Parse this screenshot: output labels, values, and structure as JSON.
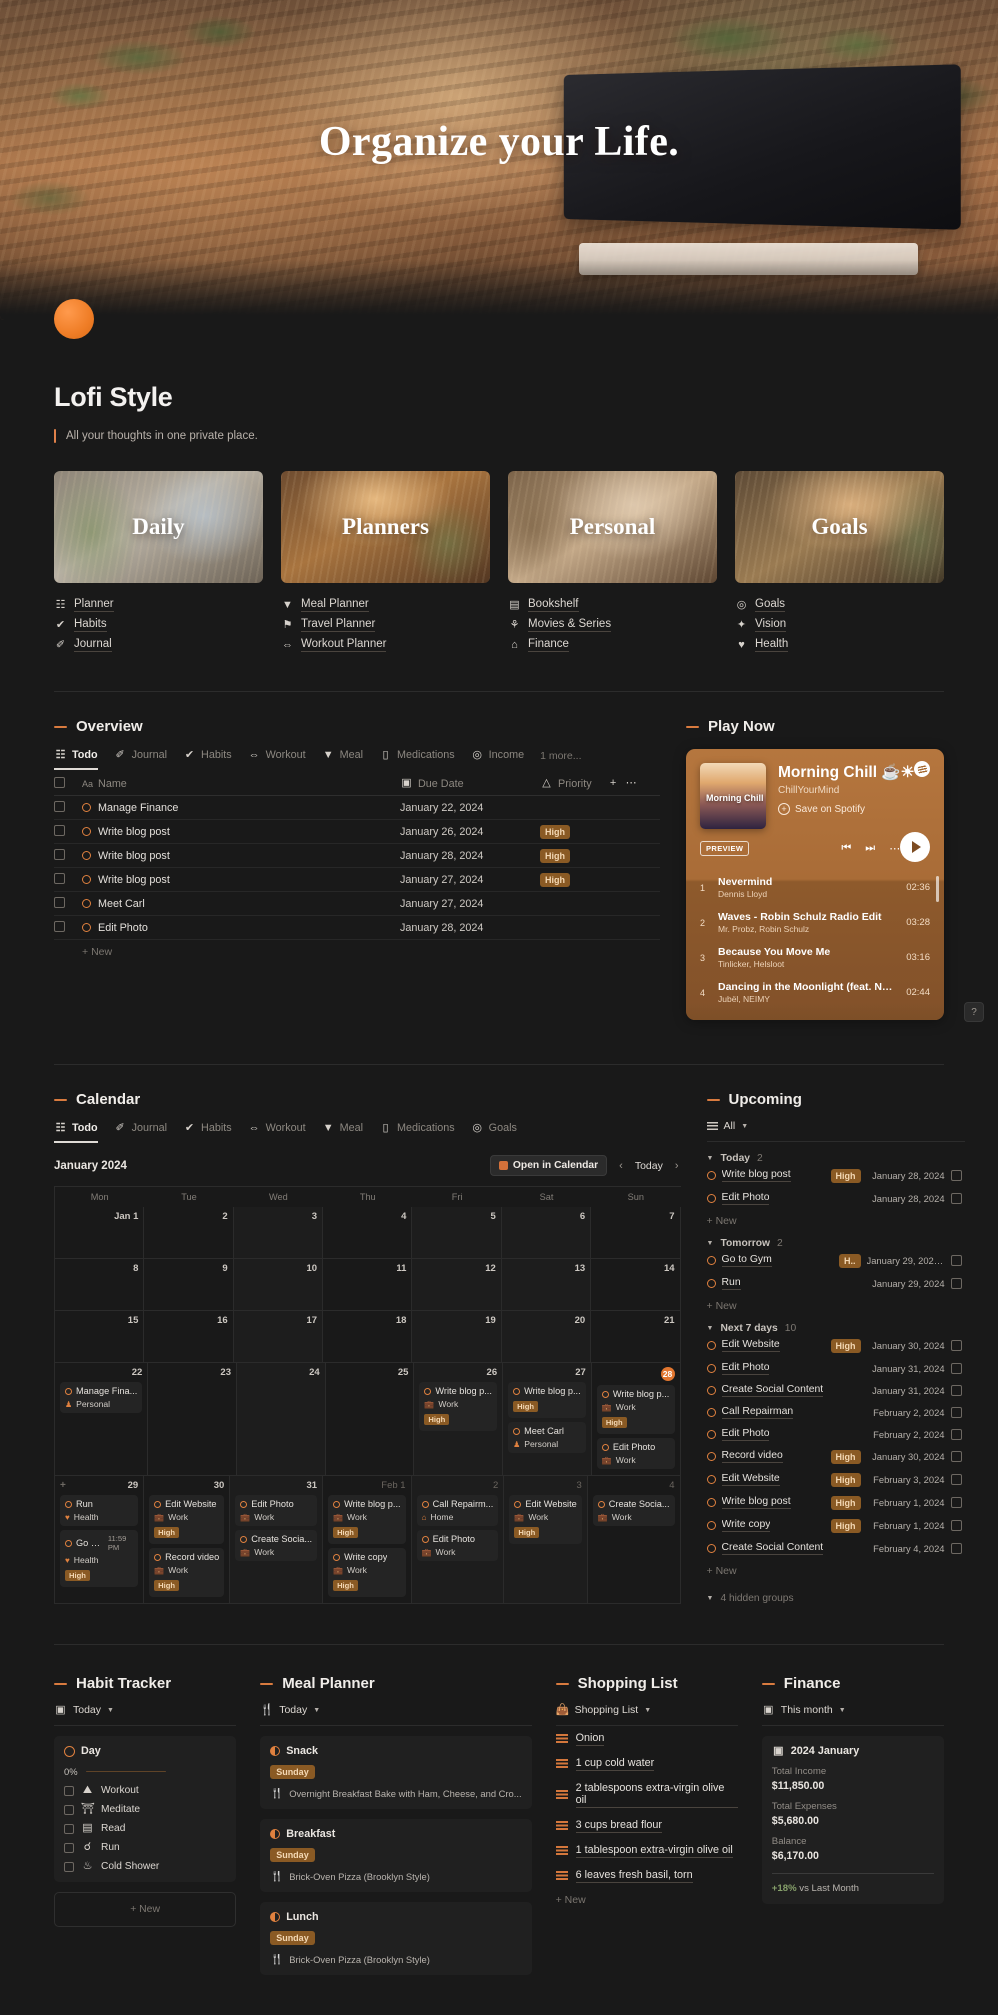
{
  "hero": {
    "title": "Organize your Life.",
    "icon": "orange-circle-icon"
  },
  "page": {
    "title": "Lofi Style",
    "callout": "All your thoughts in one private place."
  },
  "cards": [
    {
      "caption": "Daily",
      "links": [
        {
          "icon": "calendar-icon",
          "glyph": "☷",
          "label": "Planner"
        },
        {
          "icon": "check-circle-icon",
          "glyph": "✔",
          "label": "Habits"
        },
        {
          "icon": "pen-icon",
          "glyph": "✐",
          "label": "Journal"
        }
      ]
    },
    {
      "caption": "Planners",
      "links": [
        {
          "icon": "bowl-icon",
          "glyph": "▼",
          "label": "Meal Planner"
        },
        {
          "icon": "pin-icon",
          "glyph": "⚑",
          "label": "Travel Planner"
        },
        {
          "icon": "dumbbell-icon",
          "glyph": "⇔",
          "label": "Workout Planner"
        }
      ]
    },
    {
      "caption": "Personal",
      "links": [
        {
          "icon": "book-icon",
          "glyph": "▤",
          "label": "Bookshelf"
        },
        {
          "icon": "film-icon",
          "glyph": "⚘",
          "label": "Movies & Series"
        },
        {
          "icon": "bank-icon",
          "glyph": "⌂",
          "label": "Finance"
        }
      ]
    },
    {
      "caption": "Goals",
      "links": [
        {
          "icon": "target-icon",
          "glyph": "◎",
          "label": "Goals"
        },
        {
          "icon": "sparkle-icon",
          "glyph": "✦",
          "label": "Vision"
        },
        {
          "icon": "heart-icon",
          "glyph": "♥",
          "label": "Health"
        }
      ]
    }
  ],
  "overview": {
    "heading": "Overview",
    "tabs": [
      {
        "label": "Todo",
        "glyph": "☷",
        "active": true
      },
      {
        "label": "Journal",
        "glyph": "✐",
        "active": false
      },
      {
        "label": "Habits",
        "glyph": "✔",
        "active": false
      },
      {
        "label": "Workout",
        "glyph": "⇔",
        "active": false
      },
      {
        "label": "Meal",
        "glyph": "▼",
        "active": false
      },
      {
        "label": "Medications",
        "glyph": "▯",
        "active": false
      },
      {
        "label": "Income",
        "glyph": "◎",
        "active": false
      }
    ],
    "tab_more": "1 more...",
    "columns": {
      "name": "Name",
      "name_prefix": "Aa",
      "due": "Due Date",
      "priority": "Priority"
    },
    "rows": [
      {
        "name": "Manage Finance",
        "due": "January 22, 2024",
        "priority": ""
      },
      {
        "name": "Write blog post",
        "due": "January 26, 2024",
        "priority": "High"
      },
      {
        "name": "Write blog post",
        "due": "January 28, 2024",
        "priority": "High"
      },
      {
        "name": "Write blog post",
        "due": "January 27, 2024",
        "priority": "High"
      },
      {
        "name": "Meet Carl",
        "due": "January 27, 2024",
        "priority": ""
      },
      {
        "name": "Edit Photo",
        "due": "January 28, 2024",
        "priority": ""
      }
    ],
    "new_label": "New"
  },
  "play_now": {
    "heading": "Play Now",
    "cover_label": "Morning Chill",
    "title": "Morning Chill ☕☀",
    "artist": "ChillYourMind",
    "save_label": "Save on Spotify",
    "preview_label": "PREVIEW",
    "tracks": [
      {
        "num": "1",
        "name": "Nevermind",
        "artist": "Dennis Lloyd",
        "duration": "02:36"
      },
      {
        "num": "2",
        "name": "Waves - Robin Schulz Radio Edit",
        "artist": "Mr. Probz, Robin Schulz",
        "duration": "03:28"
      },
      {
        "num": "3",
        "name": "Because You Move Me",
        "artist": "Tinlicker, Helsloot",
        "duration": "03:16"
      },
      {
        "num": "4",
        "name": "Dancing in the Moonlight (feat. NEIMY)",
        "artist": "Jubël, NEIMY",
        "duration": "02:44"
      }
    ]
  },
  "calendar": {
    "heading": "Calendar",
    "tabs": [
      {
        "label": "Todo",
        "glyph": "☷",
        "active": true
      },
      {
        "label": "Journal",
        "glyph": "✐",
        "active": false
      },
      {
        "label": "Habits",
        "glyph": "✔",
        "active": false
      },
      {
        "label": "Workout",
        "glyph": "⇔",
        "active": false
      },
      {
        "label": "Meal",
        "glyph": "▼",
        "active": false
      },
      {
        "label": "Medications",
        "glyph": "▯",
        "active": false
      },
      {
        "label": "Goals",
        "glyph": "◎",
        "active": false
      }
    ],
    "month": "January 2024",
    "open_in_calendar": "Open in Calendar",
    "today": "Today",
    "prev": "‹",
    "next": "›",
    "dow": [
      "Mon",
      "Tue",
      "Wed",
      "Thu",
      "Fri",
      "Sat",
      "Sun"
    ],
    "weeks": [
      {
        "tall": false,
        "days": [
          {
            "num": "Jan 1",
            "alt": false,
            "events": []
          },
          {
            "num": "2",
            "alt": false,
            "events": []
          },
          {
            "num": "3",
            "alt": true,
            "events": []
          },
          {
            "num": "4",
            "alt": false,
            "events": []
          },
          {
            "num": "5",
            "alt": true,
            "events": []
          },
          {
            "num": "6",
            "alt": true,
            "events": []
          },
          {
            "num": "7",
            "alt": false,
            "events": []
          }
        ]
      },
      {
        "tall": false,
        "days": [
          {
            "num": "8",
            "alt": false,
            "events": []
          },
          {
            "num": "9",
            "alt": false,
            "events": []
          },
          {
            "num": "10",
            "alt": true,
            "events": []
          },
          {
            "num": "11",
            "alt": false,
            "events": []
          },
          {
            "num": "12",
            "alt": true,
            "events": []
          },
          {
            "num": "13",
            "alt": true,
            "events": []
          },
          {
            "num": "14",
            "alt": false,
            "events": []
          }
        ]
      },
      {
        "tall": false,
        "days": [
          {
            "num": "15",
            "alt": false,
            "events": []
          },
          {
            "num": "16",
            "alt": false,
            "events": []
          },
          {
            "num": "17",
            "alt": true,
            "events": []
          },
          {
            "num": "18",
            "alt": false,
            "events": []
          },
          {
            "num": "19",
            "alt": true,
            "events": []
          },
          {
            "num": "20",
            "alt": true,
            "events": []
          },
          {
            "num": "21",
            "alt": false,
            "events": []
          }
        ]
      },
      {
        "tall": true,
        "days": [
          {
            "num": "22",
            "alt": false,
            "events": [
              {
                "title": "Manage Fina...",
                "tag": "Personal",
                "tag_icon": "person-icon",
                "priority": ""
              }
            ]
          },
          {
            "num": "23",
            "alt": false,
            "events": []
          },
          {
            "num": "24",
            "alt": true,
            "events": []
          },
          {
            "num": "25",
            "alt": false,
            "events": []
          },
          {
            "num": "26",
            "alt": true,
            "events": [
              {
                "title": "Write blog p...",
                "tag": "Work",
                "tag_icon": "briefcase-icon",
                "priority": "High"
              }
            ]
          },
          {
            "num": "27",
            "alt": true,
            "events": [
              {
                "title": "Write blog p...",
                "tag": "",
                "tag_icon": "",
                "priority": "High"
              },
              {
                "title": "Meet Carl",
                "tag": "Personal",
                "tag_icon": "person-icon",
                "priority": ""
              }
            ]
          },
          {
            "num": "28",
            "alt": false,
            "today": true,
            "events": [
              {
                "title": "Write blog p...",
                "tag": "Work",
                "tag_icon": "briefcase-icon",
                "priority": "High"
              },
              {
                "title": "Edit Photo",
                "tag": "Work",
                "tag_icon": "briefcase-icon",
                "priority": ""
              }
            ]
          }
        ]
      },
      {
        "tall": true,
        "days": [
          {
            "num": "29",
            "alt": false,
            "plus": true,
            "events": [
              {
                "title": "Run",
                "tag": "Health",
                "tag_icon": "heart-icon",
                "priority": ""
              },
              {
                "title": "Go to ...",
                "time": "11:59 PM",
                "tag": "Health",
                "tag_icon": "heart-icon",
                "priority": "High"
              }
            ]
          },
          {
            "num": "30",
            "alt": false,
            "events": [
              {
                "title": "Edit Website",
                "tag": "Work",
                "tag_icon": "briefcase-icon",
                "priority": "High"
              },
              {
                "title": "Record video",
                "tag": "Work",
                "tag_icon": "briefcase-icon",
                "priority": "High"
              }
            ]
          },
          {
            "num": "31",
            "alt": true,
            "events": [
              {
                "title": "Edit Photo",
                "tag": "Work",
                "tag_icon": "briefcase-icon",
                "priority": ""
              },
              {
                "title": "Create Socia...",
                "tag": "Work",
                "tag_icon": "briefcase-icon",
                "priority": ""
              }
            ]
          },
          {
            "num": "Feb 1",
            "alt": false,
            "out": true,
            "events": [
              {
                "title": "Write blog p...",
                "tag": "Work",
                "tag_icon": "briefcase-icon",
                "priority": "High"
              },
              {
                "title": "Write copy",
                "tag": "Work",
                "tag_icon": "briefcase-icon",
                "priority": "High"
              }
            ]
          },
          {
            "num": "2",
            "alt": true,
            "out": true,
            "events": [
              {
                "title": "Call Repairm...",
                "tag": "Home",
                "tag_icon": "home-icon",
                "priority": ""
              },
              {
                "title": "Edit Photo",
                "tag": "Work",
                "tag_icon": "briefcase-icon",
                "priority": ""
              }
            ]
          },
          {
            "num": "3",
            "alt": true,
            "out": true,
            "events": [
              {
                "title": "Edit Website",
                "tag": "Work",
                "tag_icon": "briefcase-icon",
                "priority": "High"
              }
            ]
          },
          {
            "num": "4",
            "alt": false,
            "out": true,
            "events": [
              {
                "title": "Create Socia...",
                "tag": "Work",
                "tag_icon": "briefcase-icon",
                "priority": ""
              }
            ]
          }
        ]
      }
    ]
  },
  "upcoming": {
    "heading": "Upcoming",
    "filter": "All",
    "groups": [
      {
        "label": "Today",
        "count": "2",
        "items": [
          {
            "name": "Write blog post",
            "priority": "High",
            "date": "January 28, 2024"
          },
          {
            "name": "Edit Photo",
            "priority": "",
            "date": "January 28, 2024"
          }
        ],
        "new_label": "New"
      },
      {
        "label": "Tomorrow",
        "count": "2",
        "items": [
          {
            "name": "Go to Gym",
            "priority": "H..",
            "date": "January 29, 2024 1..."
          },
          {
            "name": "Run",
            "priority": "",
            "date": "January 29, 2024"
          }
        ],
        "new_label": "New"
      },
      {
        "label": "Next 7 days",
        "count": "10",
        "items": [
          {
            "name": "Edit Website",
            "priority": "High",
            "date": "January 30, 2024"
          },
          {
            "name": "Edit Photo",
            "priority": "",
            "date": "January 31, 2024"
          },
          {
            "name": "Create Social Content",
            "priority": "",
            "date": "January 31, 2024"
          },
          {
            "name": "Call Repairman",
            "priority": "",
            "date": "February 2, 2024"
          },
          {
            "name": "Edit Photo",
            "priority": "",
            "date": "February 2, 2024"
          },
          {
            "name": "Record video",
            "priority": "High",
            "date": "January 30, 2024"
          },
          {
            "name": "Edit Website",
            "priority": "High",
            "date": "February 3, 2024"
          },
          {
            "name": "Write blog post",
            "priority": "High",
            "date": "February 1, 2024"
          },
          {
            "name": "Write copy",
            "priority": "High",
            "date": "February 1, 2024"
          },
          {
            "name": "Create Social Content",
            "priority": "",
            "date": "February 4, 2024"
          }
        ],
        "new_label": "New"
      }
    ],
    "hidden_groups": "4 hidden groups"
  },
  "habit_tracker": {
    "heading": "Habit Tracker",
    "filter": "Today",
    "card_title": "Day",
    "progress_label": "0%",
    "progress_value": 0,
    "habits": [
      {
        "glyph": "⛰",
        "label": "Workout"
      },
      {
        "glyph": "⛩",
        "label": "Meditate"
      },
      {
        "glyph": "▤",
        "label": "Read"
      },
      {
        "glyph": "☌",
        "label": "Run"
      },
      {
        "glyph": "♨",
        "label": "Cold Shower"
      }
    ],
    "new_label": "New"
  },
  "meal_planner": {
    "heading": "Meal Planner",
    "filter": "Today",
    "meals": [
      {
        "title": "Snack",
        "day": "Sunday",
        "recipe": "Overnight Breakfast Bake with Ham, Cheese, and Cro..."
      },
      {
        "title": "Breakfast",
        "day": "Sunday",
        "recipe": "Brick-Oven Pizza (Brooklyn Style)"
      },
      {
        "title": "Lunch",
        "day": "Sunday",
        "recipe": "Brick-Oven Pizza (Brooklyn Style)"
      }
    ]
  },
  "shopping_list": {
    "heading": "Shopping List",
    "filter": "Shopping List",
    "items": [
      "Onion",
      "1 cup cold water",
      "2 tablespoons extra-virgin olive oil",
      "3 cups bread flour",
      "1 tablespoon extra-virgin olive oil",
      "6 leaves fresh basil, torn"
    ],
    "new_label": "New"
  },
  "finance": {
    "heading": "Finance",
    "filter": "This month",
    "card_title": "2024 January",
    "rows": [
      {
        "label": "Total Income",
        "value": "$11,850.00"
      },
      {
        "label": "Total Expenses",
        "value": "$5,680.00"
      },
      {
        "label": "Balance",
        "value": "$6,170.00"
      }
    ],
    "footer_delta": "+18%",
    "footer_text": "vs Last Month"
  },
  "help_button": "?",
  "colors": {
    "accent": "#d97b3f",
    "pill_bg": "#8a5a24",
    "pill_text": "#f4d8b4",
    "today": "#e2762f"
  }
}
